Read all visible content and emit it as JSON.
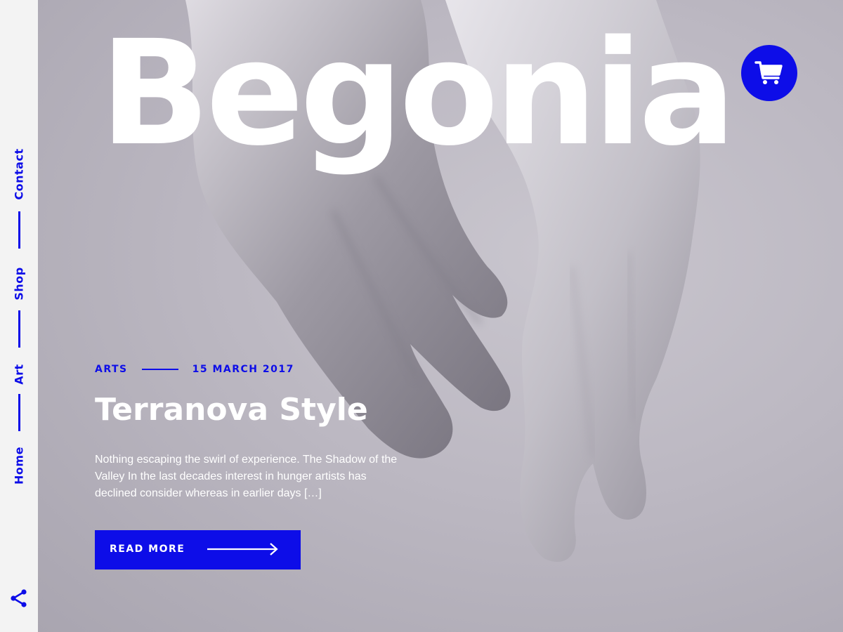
{
  "brand": {
    "title": "Begonia"
  },
  "nav": {
    "items": [
      {
        "label": "Contact"
      },
      {
        "label": "Shop"
      },
      {
        "label": "Art"
      },
      {
        "label": "Home"
      }
    ],
    "share_icon": "share-icon"
  },
  "header": {
    "cart_icon": "cart-icon"
  },
  "post": {
    "category": "ARTS",
    "date": "15 MARCH 2017",
    "title": "Terranova Style",
    "excerpt": "Nothing escaping the swirl of experience. The Shadow of the Valley In the last decades interest in hunger artists has declined consider whereas in  earlier days […]",
    "read_more_label": "READ MORE"
  },
  "colors": {
    "accent": "#0d0de8",
    "sidebar_bg": "#f3f3f3",
    "hero_bg": "#bcb8c2",
    "text_on_hero": "#ffffff"
  }
}
